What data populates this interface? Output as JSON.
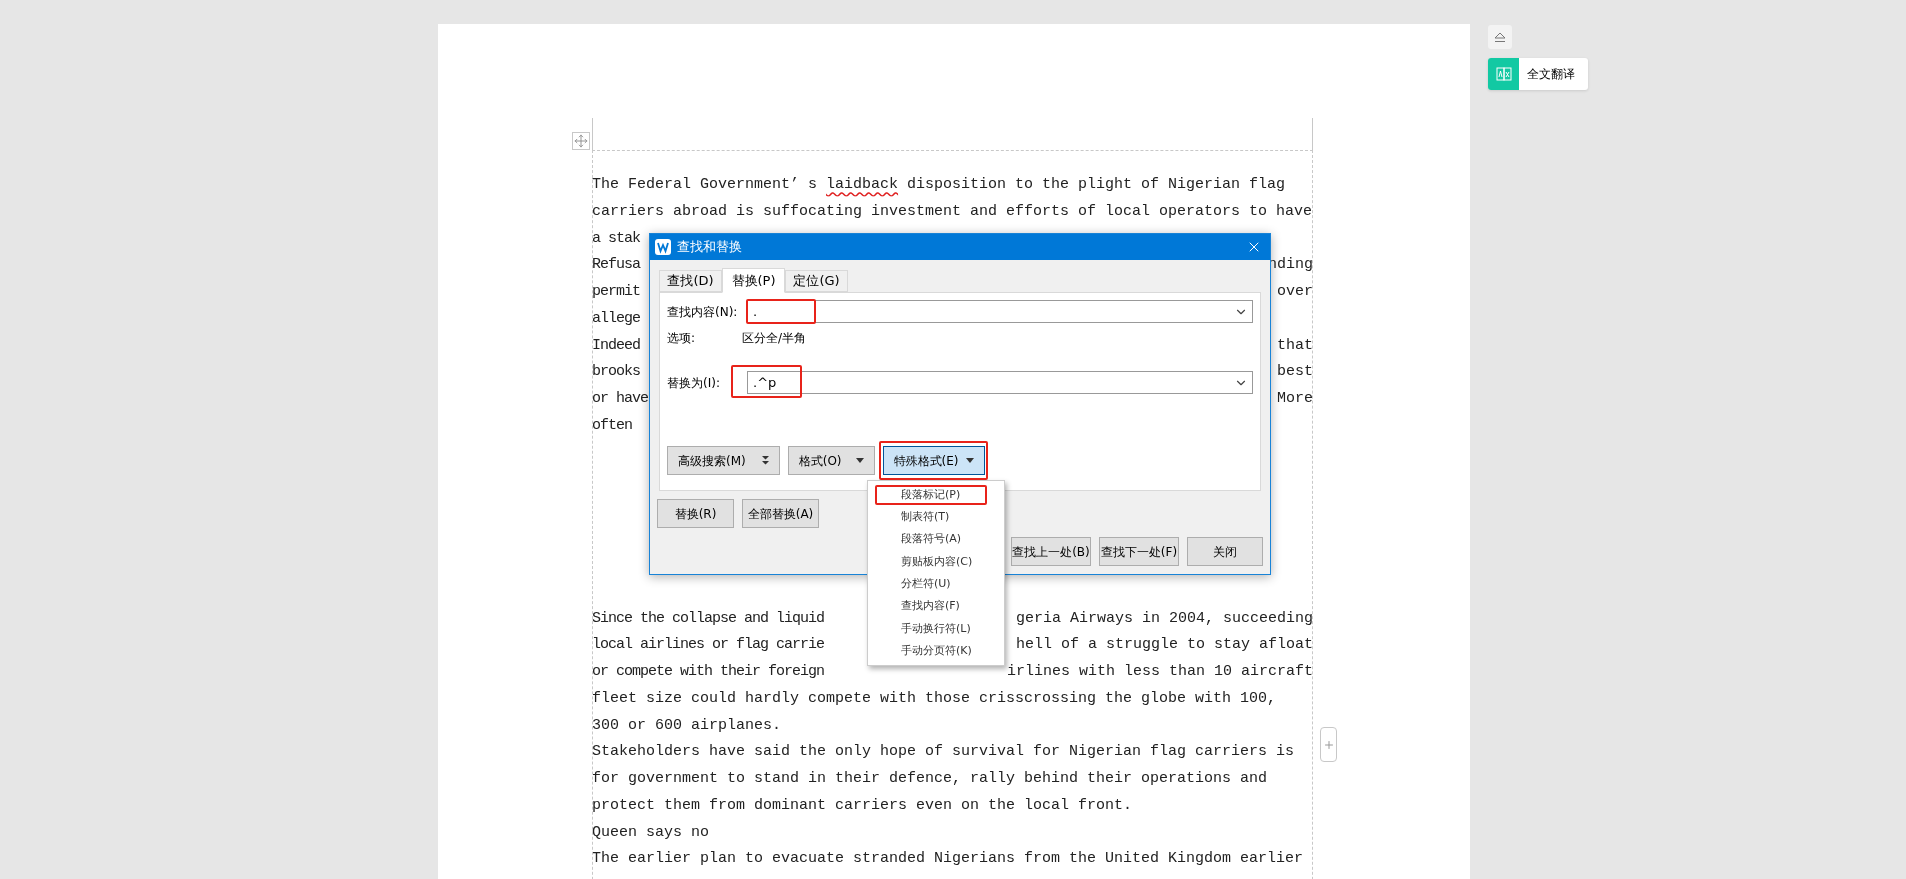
{
  "document": {
    "upper_lines": [
      {
        "kind": "full",
        "parts": [
          {
            "text": "The Federal Government’ s "
          },
          {
            "text": "laidback",
            "misspelled": true
          },
          {
            "text": " disposition to the plight of Nigerian flag"
          }
        ]
      },
      {
        "kind": "full",
        "parts": [
          {
            "text": "carriers abroad is suffocating investment and efforts of local operators to have"
          }
        ]
      },
      {
        "kind": "split",
        "left": "a stak"
      },
      {
        "kind": "split",
        "left": "Refusa",
        "right": "nding"
      },
      {
        "kind": "split",
        "left": "permit",
        "right": "over"
      },
      {
        "kind": "split",
        "left": "allege"
      },
      {
        "kind": "split",
        "left": "Indeed",
        "right": "that"
      },
      {
        "kind": "split",
        "left": "brooks",
        "right": "best"
      },
      {
        "kind": "split",
        "left": "or have",
        "right": "More"
      },
      {
        "kind": "split",
        "left": "often"
      }
    ],
    "lower_lines": [
      {
        "kind": "split",
        "left": "Since the collapse and liquid",
        "right": "geria Airways in 2004, succeeding"
      },
      {
        "kind": "split",
        "left": "local airlines or flag carrie",
        "right": "hell of a struggle to stay afloat"
      },
      {
        "kind": "split",
        "left": "or compete with their foreign",
        "right": "irlines with less than 10 aircraft"
      },
      {
        "kind": "full",
        "parts": [
          {
            "text": "fleet size could hardly compete with those crisscrossing the globe with 100,"
          }
        ]
      },
      {
        "kind": "full",
        "parts": [
          {
            "text": "300 or 600 airplanes."
          }
        ]
      },
      {
        "kind": "full",
        "parts": [
          {
            "text": "Stakeholders have said the only hope of survival for Nigerian flag carriers is"
          }
        ]
      },
      {
        "kind": "full",
        "parts": [
          {
            "text": "for government to stand in their defence, rally behind their operations and"
          }
        ]
      },
      {
        "kind": "full",
        "parts": [
          {
            "text": "protect them from dominant carriers even on the local front."
          }
        ]
      },
      {
        "kind": "full",
        "parts": [
          {
            "text": "Queen says no"
          }
        ]
      },
      {
        "kind": "full",
        "parts": [
          {
            "text": "The earlier plan to evacuate stranded Nigerians from the United Kingdom earlier"
          }
        ]
      }
    ]
  },
  "side_panel": {
    "translate_button": "全文翻译"
  },
  "dialog": {
    "title": "查找和替换",
    "tabs": [
      {
        "label": "查找(D)",
        "selected": false
      },
      {
        "label": "替换(P)",
        "selected": true
      },
      {
        "label": "定位(G)",
        "selected": false
      }
    ],
    "find": {
      "label": "查找内容(N):",
      "value": ".",
      "annotated": true
    },
    "options": {
      "label": "选项:",
      "value": "区分全/半角"
    },
    "replace": {
      "label": "替换为(I):",
      "value": ".^p",
      "annotated": true
    },
    "option_buttons": [
      {
        "label": "高级搜索(M)",
        "kind": "expand",
        "pressed": false,
        "annotated": false
      },
      {
        "label": "格式(O)",
        "kind": "dropdown",
        "pressed": false,
        "annotated": false
      },
      {
        "label": "特殊格式(E)",
        "kind": "dropdown",
        "pressed": true,
        "annotated": true
      }
    ],
    "replace_buttons": [
      "替换(R)",
      "全部替换(A)"
    ],
    "nav_buttons": [
      "查找上一处(B)",
      "查找下一处(F)",
      "关闭"
    ],
    "menu": {
      "items": [
        {
          "label": "段落标记(P)",
          "annotated": true
        },
        {
          "label": "制表符(T)",
          "annotated": false
        },
        {
          "label": "段落符号(A)",
          "annotated": false
        },
        {
          "label": "剪贴板内容(C)",
          "annotated": false
        },
        {
          "label": "分栏符(U)",
          "annotated": false
        },
        {
          "label": "查找内容(F)",
          "annotated": false
        },
        {
          "label": "手动换行符(L)",
          "annotated": false
        },
        {
          "label": "手动分页符(K)",
          "annotated": false
        }
      ]
    }
  }
}
